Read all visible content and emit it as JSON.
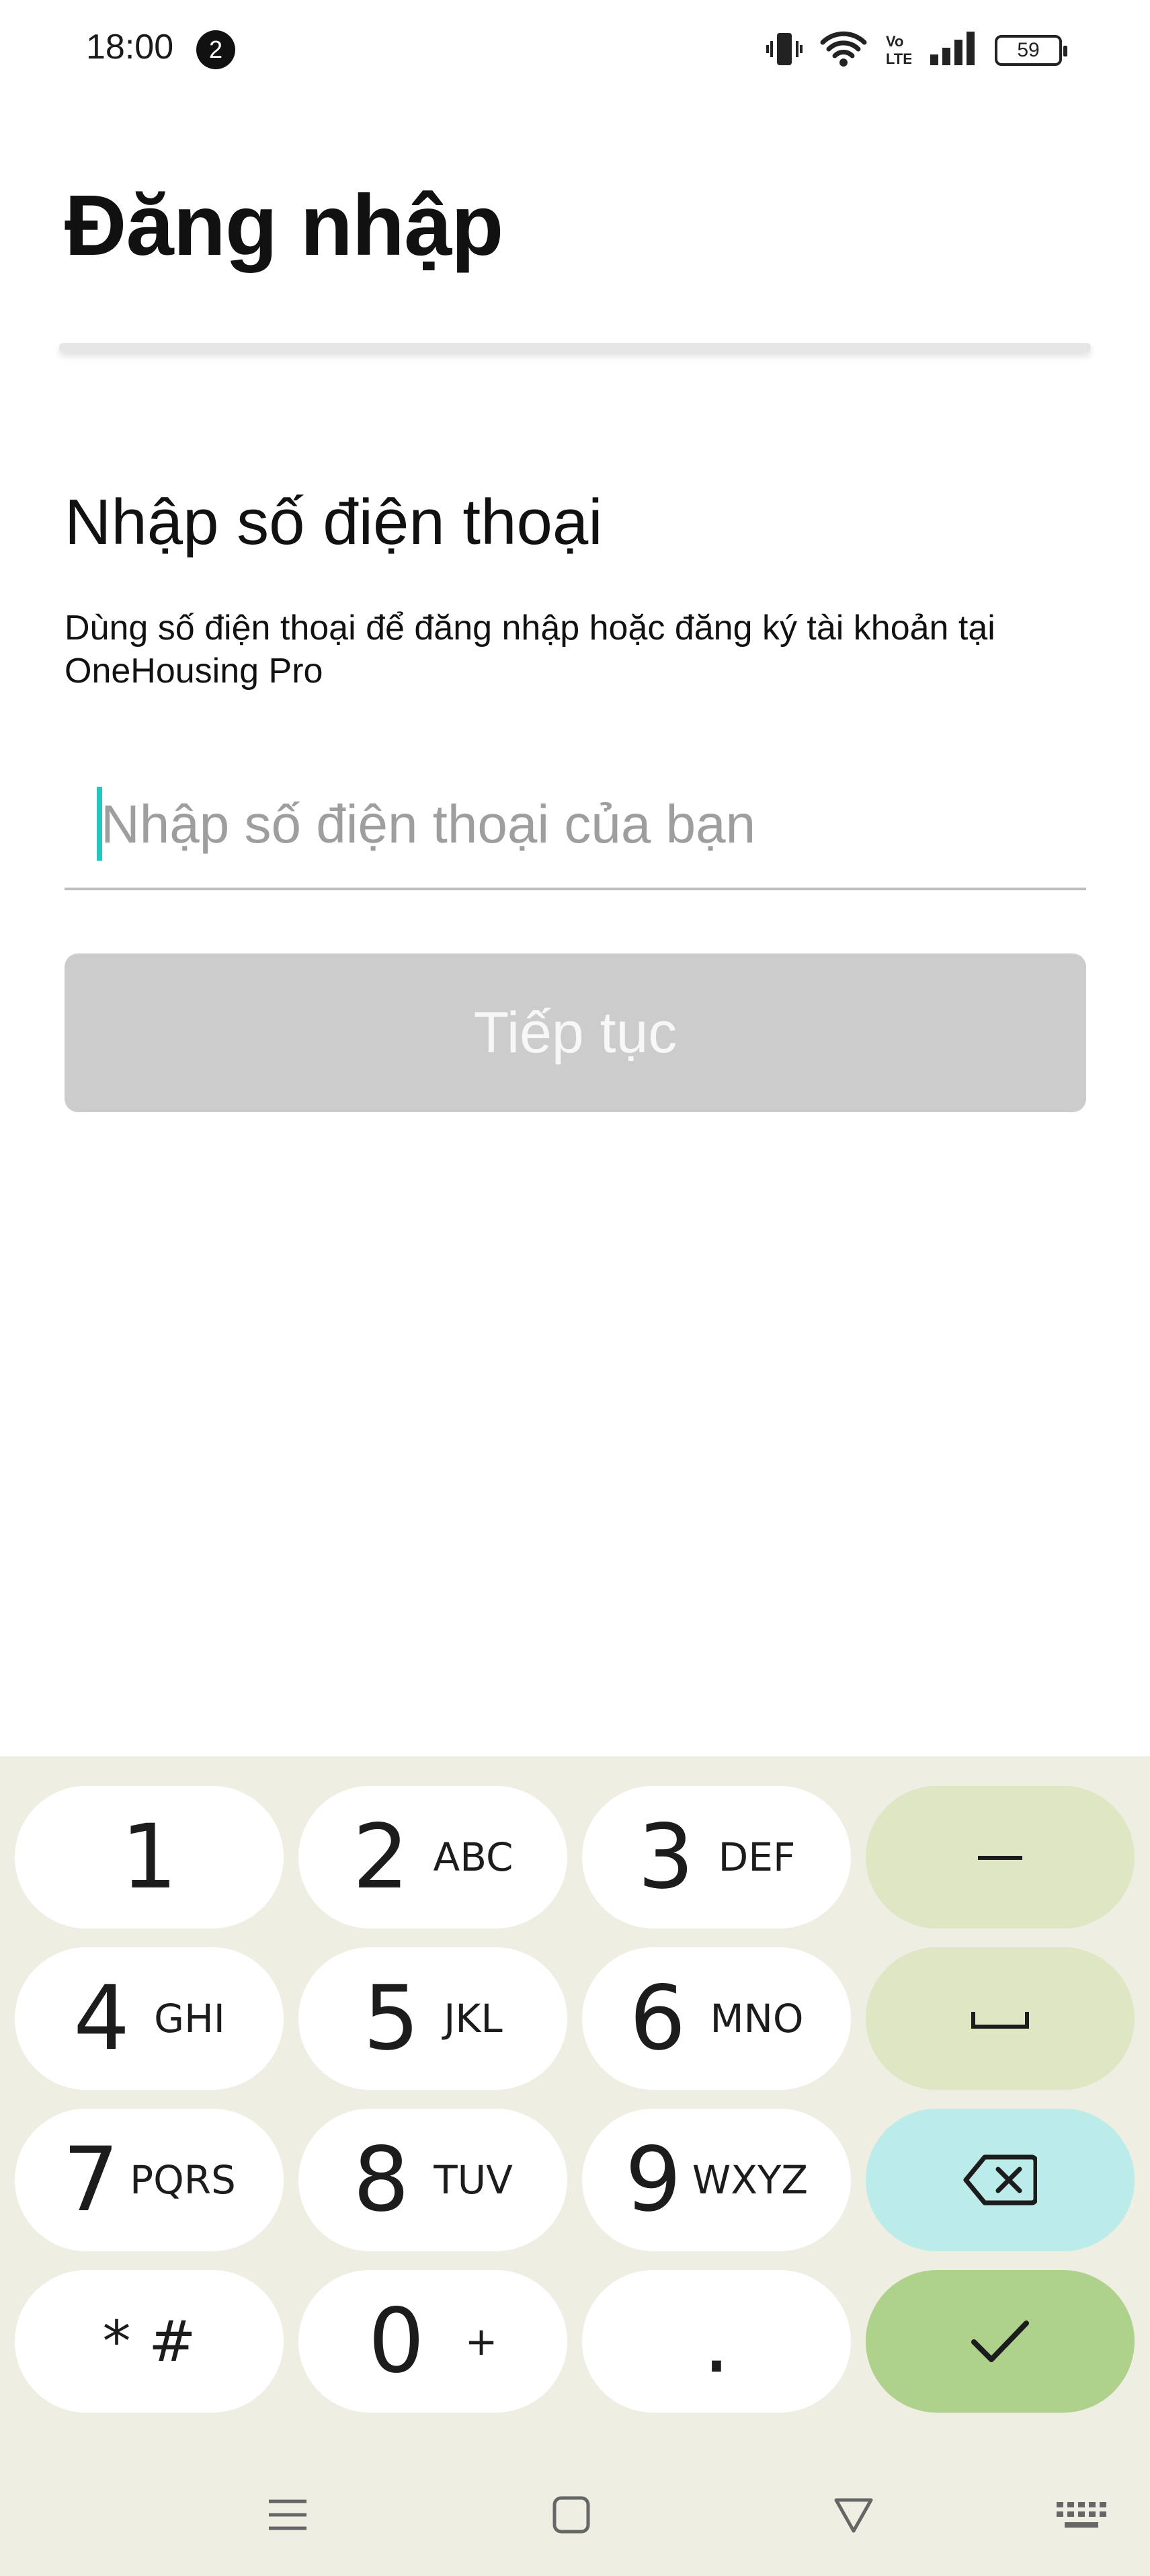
{
  "status_bar": {
    "time": "18:00",
    "notification_count": "2",
    "battery": "59",
    "icons": [
      "vibrate-icon",
      "wifi-icon",
      "volte-icon",
      "signal-icon",
      "battery-icon"
    ]
  },
  "header": {
    "title": "Đăng nhập"
  },
  "form": {
    "heading": "Nhập số điện thoại",
    "description": "Dùng số điện thoại để đăng nhập hoặc đăng ký tài khoản tại OneHousing Pro",
    "phone_placeholder": "Nhập số điện thoại của bạn",
    "phone_value": "",
    "continue_label": "Tiếp tục"
  },
  "keypad": {
    "keys": [
      {
        "digit": "1",
        "letters": ""
      },
      {
        "digit": "2",
        "letters": "ABC"
      },
      {
        "digit": "3",
        "letters": "DEF"
      },
      {
        "digit": "4",
        "letters": "GHI"
      },
      {
        "digit": "5",
        "letters": "JKL"
      },
      {
        "digit": "6",
        "letters": "MNO"
      },
      {
        "digit": "7",
        "letters": "PQRS"
      },
      {
        "digit": "8",
        "letters": "TUV"
      },
      {
        "digit": "9",
        "letters": "WXYZ"
      },
      {
        "digit": "* #",
        "letters": ""
      },
      {
        "digit": "0",
        "letters": "+"
      },
      {
        "digit": ".",
        "letters": ""
      }
    ],
    "functions": [
      "minus-key",
      "space-key",
      "backspace-key",
      "done-key"
    ],
    "colors": {
      "background": "#eeeee2",
      "key": "#ffffff",
      "func": "#dee6c3",
      "backspace": "#bbecea",
      "done": "#aed18c"
    }
  },
  "nav_bar": {
    "buttons": [
      "menu-icon",
      "home-icon",
      "back-icon",
      "keyboard-icon"
    ]
  }
}
